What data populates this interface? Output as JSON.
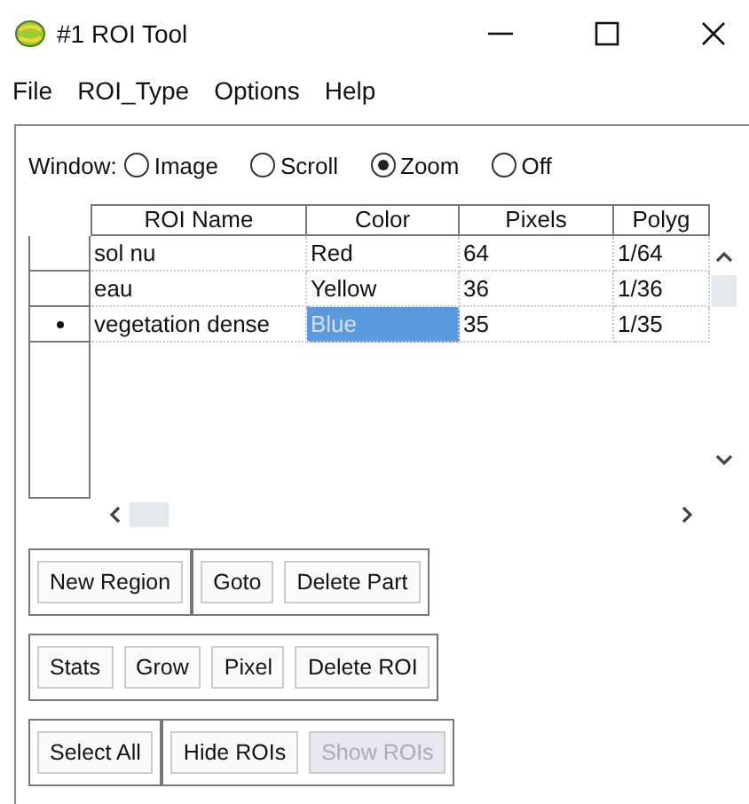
{
  "window": {
    "title": "#1 ROI Tool"
  },
  "menu": [
    "File",
    "ROI_Type",
    "Options",
    "Help"
  ],
  "window_mode": {
    "label": "Window:",
    "options": [
      {
        "label": "Image",
        "selected": false
      },
      {
        "label": "Scroll",
        "selected": false
      },
      {
        "label": "Zoom",
        "selected": true
      },
      {
        "label": "Off",
        "selected": false
      }
    ]
  },
  "table": {
    "columns": [
      "ROI Name",
      "Color",
      "Pixels",
      "Polyg"
    ],
    "rows": [
      {
        "name": "sol nu",
        "color_name": "Red",
        "pixels": "64",
        "polygons": "1/64",
        "current": false,
        "selected": false
      },
      {
        "name": "eau",
        "color_name": "Yellow",
        "pixels": "36",
        "polygons": "1/36",
        "current": false,
        "selected": false
      },
      {
        "name": "vegetation dense",
        "color_name": "Blue",
        "pixels": "35",
        "polygons": "1/35",
        "current": true,
        "selected": true
      }
    ]
  },
  "button_rows": [
    [
      [
        {
          "label": "New Region",
          "disabled": false
        }
      ],
      [
        {
          "label": "Goto",
          "disabled": false
        },
        {
          "label": "Delete Part",
          "disabled": false
        }
      ]
    ],
    [
      [
        {
          "label": "Stats",
          "disabled": false
        },
        {
          "label": "Grow",
          "disabled": false
        },
        {
          "label": "Pixel",
          "disabled": false
        },
        {
          "label": "Delete ROI",
          "disabled": false
        }
      ]
    ],
    [
      [
        {
          "label": "Select All",
          "disabled": false
        }
      ],
      [
        {
          "label": "Hide ROIs",
          "disabled": false
        },
        {
          "label": "Show ROIs",
          "disabled": true
        }
      ]
    ]
  ]
}
